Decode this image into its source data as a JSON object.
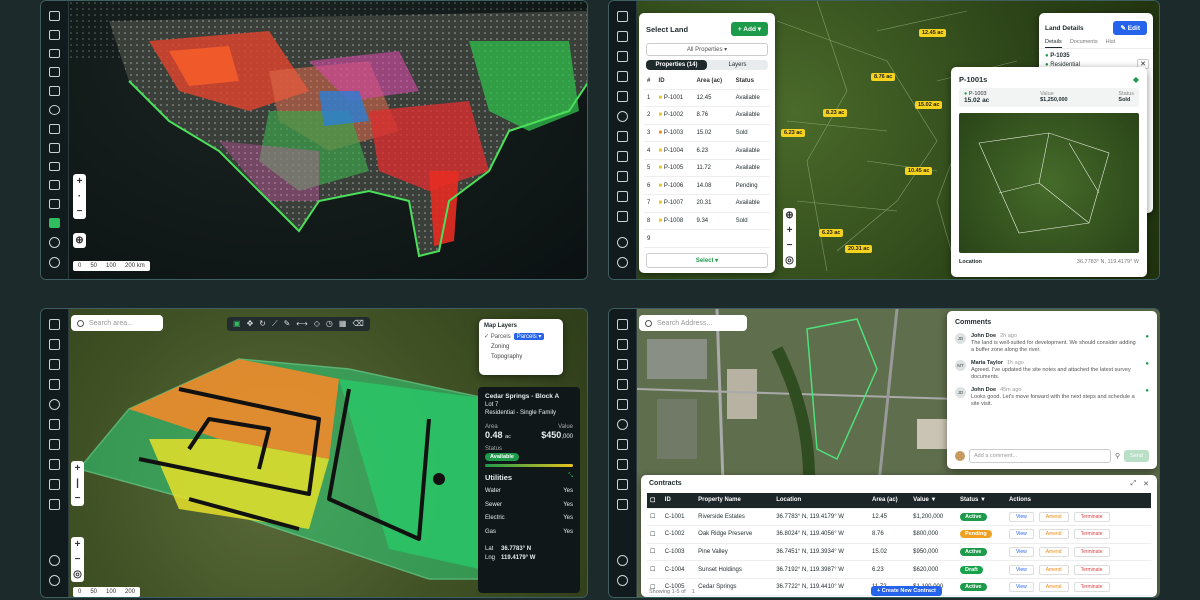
{
  "panel1": {
    "zoom": {
      "plus": "+",
      "minus": "−",
      "alt_plus": "+",
      "alt_minus": "−"
    },
    "scale": [
      "0",
      "50",
      "100",
      "200 km"
    ]
  },
  "panel2": {
    "select_land": {
      "title": "Select Land",
      "add_label": "+ Add ▾",
      "filter": "All Properties ▾",
      "tabs": [
        "Properties (14)",
        "Layers"
      ],
      "columns": [
        "#",
        "ID",
        "Area (ac)",
        "Status"
      ],
      "rows": [
        {
          "n": "1",
          "id": "P-1001",
          "area": "12.45",
          "status": "Available",
          "c": "#f0c419"
        },
        {
          "n": "2",
          "id": "P-1002",
          "area": "8.76",
          "status": "Available",
          "c": "#f0c419"
        },
        {
          "n": "3",
          "id": "P-1003",
          "area": "15.02",
          "status": "Sold",
          "c": "#f08a19"
        },
        {
          "n": "4",
          "id": "P-1004",
          "area": "6.23",
          "status": "Available",
          "c": "#f0c419"
        },
        {
          "n": "5",
          "id": "P-1005",
          "area": "11.72",
          "status": "Available",
          "c": "#f0c419"
        },
        {
          "n": "6",
          "id": "P-1006",
          "area": "14.08",
          "status": "Pending",
          "c": "#f0c419"
        },
        {
          "n": "7",
          "id": "P-1007",
          "area": "20.31",
          "status": "Available",
          "c": "#f0c419"
        },
        {
          "n": "8",
          "id": "P-1008",
          "area": "9.34",
          "status": "Sold",
          "c": "#f0c419"
        },
        {
          "n": "9",
          "id": "",
          "area": "",
          "status": "",
          "c": ""
        }
      ],
      "select_btn": "Select ▾"
    },
    "map_labels": [
      "12.45 ac",
      "8.76 ac",
      "15.02 ac",
      "8.23 ac",
      "6.23 ac",
      "10.45 ac",
      "15.02 ac",
      "6.23 ac",
      "20.31 ac"
    ],
    "land_details": {
      "title": "Land Details",
      "edit": "✎ Edit",
      "tabs": [
        "Details",
        "Documents",
        "Hist"
      ],
      "items": [
        "P-1035",
        "Residential"
      ]
    },
    "parcel": {
      "title": "P-1001s",
      "id": "P-1003",
      "area": "15.02 ac",
      "value_label": "Value",
      "value": "$1,250,000",
      "status_label": "Status",
      "status": "Sold",
      "location_label": "Location",
      "location": "36.7783° N, 119.4179° W"
    }
  },
  "panel3": {
    "search_placeholder": "Search area...",
    "layers": {
      "title": "Map Layers",
      "items": [
        "Parcels",
        "Parcels",
        "Zoning",
        "Topography"
      ]
    },
    "info": {
      "title": "Cedar Springs - Block A",
      "lot": "Lot 7",
      "use": "Residential - Single Family",
      "area_label": "Area",
      "area": "0.48",
      "area_unit": "ac",
      "value_label": "Value",
      "value": "$450",
      "value_suffix": ",000",
      "status_label": "Status",
      "status": "Available",
      "utilities_title": "Utilities",
      "utilities": [
        {
          "k": "Water",
          "v": "Yes"
        },
        {
          "k": "Sewer",
          "v": "Yes"
        },
        {
          "k": "Electric",
          "v": "Yes"
        },
        {
          "k": "Gas",
          "v": "Yes"
        }
      ],
      "lat_label": "Lat",
      "lat": "36.7783° N",
      "lng_label": "Lng",
      "lng": "119.4179° W"
    },
    "scale": [
      "0",
      "50",
      "100",
      "200"
    ]
  },
  "panel4": {
    "search_placeholder": "Search Address...",
    "comments": {
      "title": "Comments",
      "items": [
        {
          "initials": "JD",
          "name": "John Doe",
          "time": "2h ago",
          "text": "The land is well-suited for development. We should consider adding a buffer zone along the river."
        },
        {
          "initials": "MT",
          "name": "Maria Taylor",
          "time": "1h ago",
          "text": "Agreed. I've updated the site notes and attached the latest survey documents."
        },
        {
          "initials": "JD",
          "name": "John Doe",
          "time": "45m ago",
          "text": "Looks good. Let's move forward with the next steps and schedule a site visit."
        }
      ],
      "input_placeholder": "Add a comment...",
      "send": "Send"
    },
    "contracts": {
      "title": "Contracts",
      "columns": [
        "",
        "ID",
        "Property Name",
        "Location",
        "Area (ac)",
        "Value ▼",
        "Status ▼",
        "Actions"
      ],
      "rows": [
        {
          "id": "C-1001",
          "name": "Riverside Estates",
          "loc": "36.7783° N, 119.4179° W",
          "area": "12.45",
          "value": "$1,200,000",
          "status": "Active"
        },
        {
          "id": "C-1002",
          "name": "Oak Ridge Preserve",
          "loc": "36.8024° N, 119.4056° W",
          "area": "8.76",
          "value": "$800,000",
          "status": "Pending"
        },
        {
          "id": "C-1003",
          "name": "Pine Valley",
          "loc": "36.7451° N, 119.3934° W",
          "area": "15.02",
          "value": "$950,000",
          "status": "Active"
        },
        {
          "id": "C-1004",
          "name": "Sunset Holdings",
          "loc": "36.7192° N, 119.3987° W",
          "area": "6.23",
          "value": "$620,000",
          "status": "Draft"
        },
        {
          "id": "C-1005",
          "name": "Cedar Springs",
          "loc": "36.7722° N, 119.4410° W",
          "area": "11.72",
          "value": "$1,100,000",
          "status": "Active"
        }
      ],
      "actions": [
        "View",
        "Amend",
        "Terminate"
      ],
      "footer": "Showing 1-5 of",
      "pages": "1",
      "create": "+ Create New Contract"
    }
  },
  "colors": {
    "accent": "#1e9a4b",
    "blue": "#2563eb",
    "pending": "#f0a020",
    "draft": "#16a34a"
  }
}
